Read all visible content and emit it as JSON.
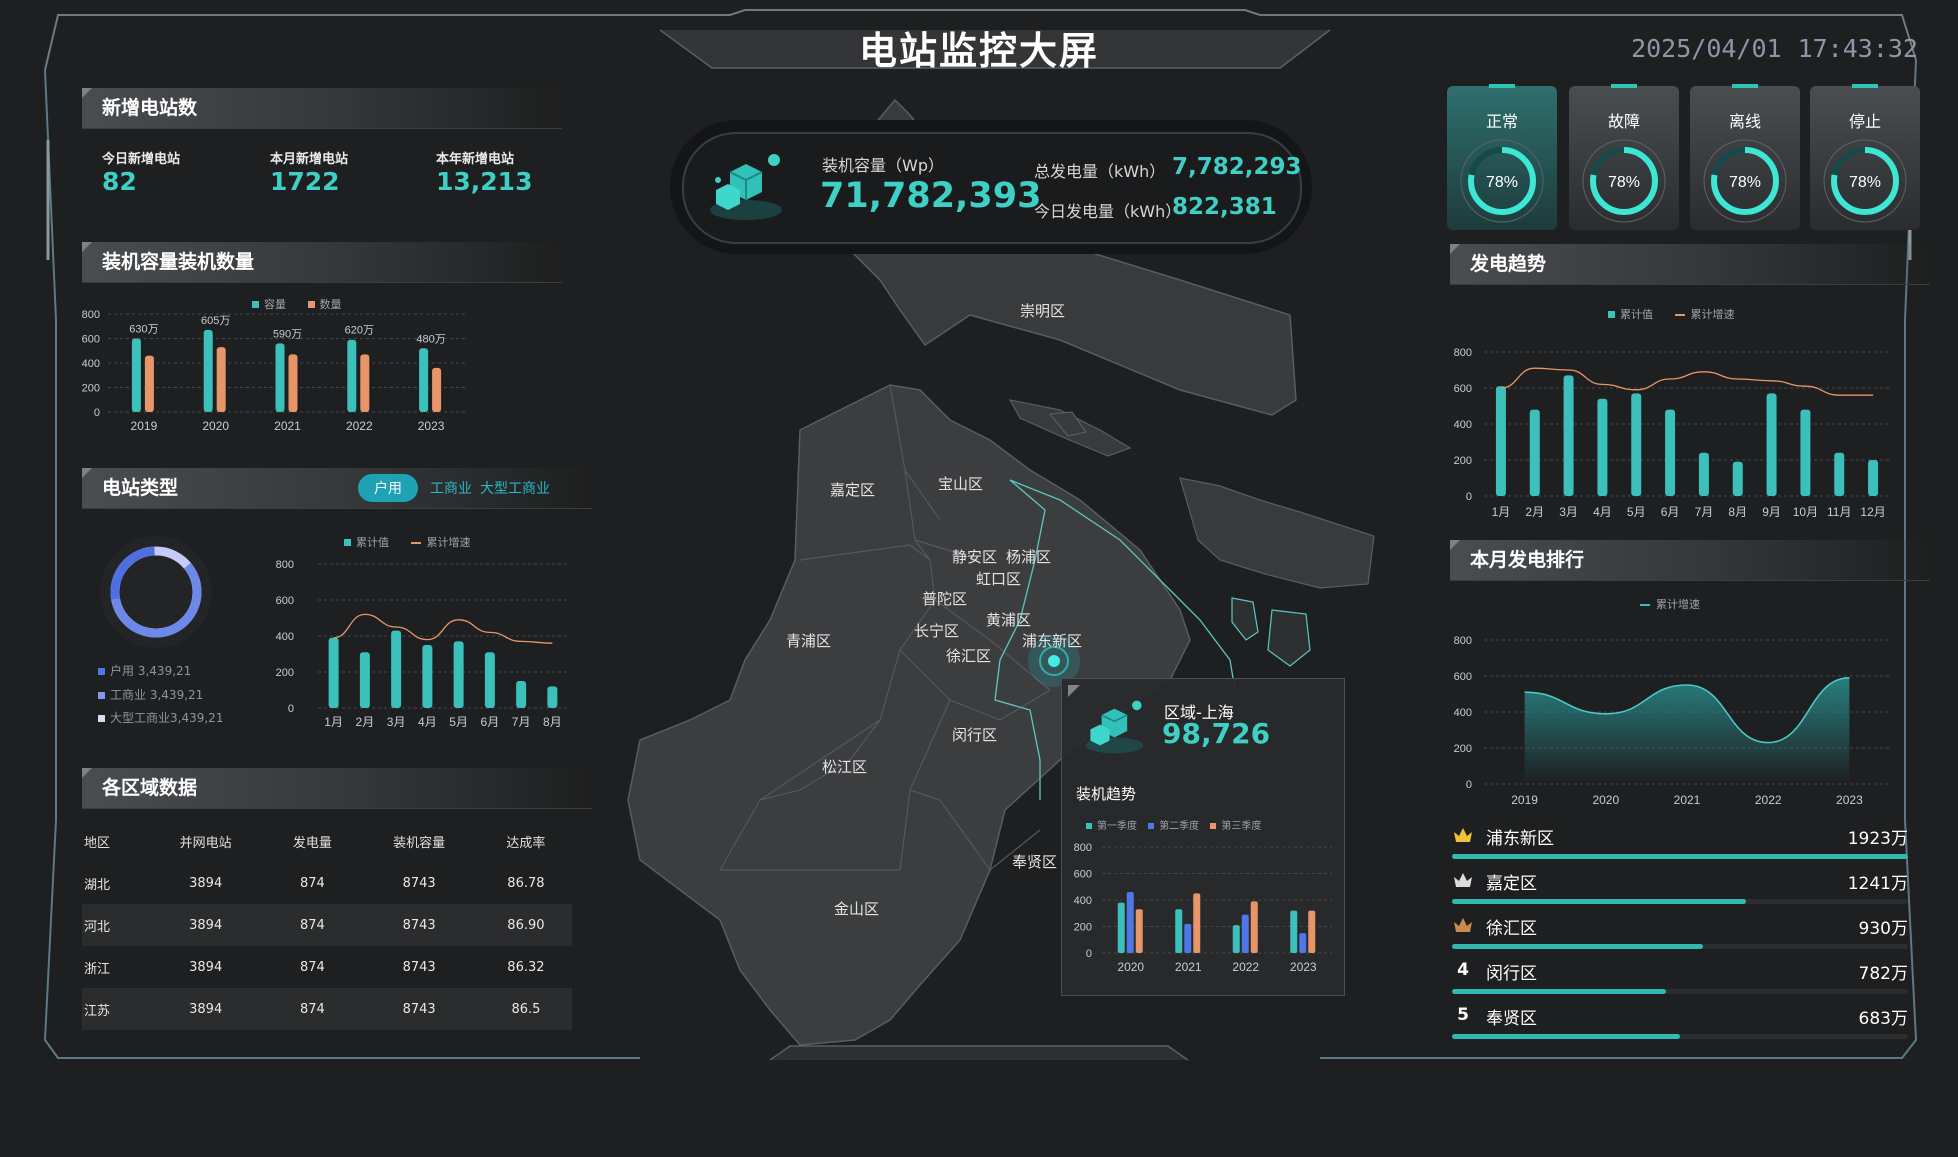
{
  "header": {
    "title": "电站监控大屏",
    "date": "2025/04/01",
    "time": "17:43:32"
  },
  "new_stations": {
    "title": "新增电站数",
    "items": [
      {
        "label": "今日新增电站",
        "value": "82"
      },
      {
        "label": "本月新增电站",
        "value": "1722"
      },
      {
        "label": "本年新增电站",
        "value": "13,213"
      }
    ]
  },
  "capacity_chart": {
    "title": "装机容量装机数量",
    "legend": [
      "容量",
      "数量"
    ]
  },
  "station_type": {
    "title": "电站类型",
    "tabs": [
      "户用",
      "工商业",
      "大型工商业"
    ],
    "donut_legend": [
      {
        "label": "户用",
        "value": "3,439,21"
      },
      {
        "label": "工商业",
        "value": "3,439,21"
      },
      {
        "label": "大型工商业",
        "value": "3,439,21"
      }
    ],
    "legend": [
      "累计值",
      "累计增速"
    ]
  },
  "region_data": {
    "title": "各区域数据",
    "columns": [
      "地区",
      "并网电站",
      "发电量",
      "装机容量",
      "达成率"
    ],
    "rows": [
      [
        "湖北",
        "3894",
        "874",
        "8743",
        "86.78"
      ],
      [
        "河北",
        "3894",
        "874",
        "8743",
        "86.90"
      ],
      [
        "浙江",
        "3894",
        "874",
        "8743",
        "86.32"
      ],
      [
        "江苏",
        "3894",
        "874",
        "8743",
        "86.5"
      ]
    ]
  },
  "summary": {
    "capacity_label": "装机容量（Wp）",
    "capacity_value": "71,782,393",
    "total_gen_label": "总发电量（kWh）",
    "total_gen_value": "7,782,293",
    "today_gen_label": "今日发电量（kWh）",
    "today_gen_value": "822,381"
  },
  "map": {
    "districts": [
      "崇明区",
      "嘉定区",
      "宝山区",
      "静安区",
      "杨浦区",
      "虹口区",
      "普陀区",
      "黄浦区",
      "长宁区",
      "青浦区",
      "徐汇区",
      "浦东新区",
      "闵行区",
      "松江区",
      "奉贤区",
      "金山区"
    ]
  },
  "popup": {
    "region": "区域-上海",
    "value": "98,726",
    "subtitle": "装机趋势",
    "legend": [
      "第一季度",
      "第二季度",
      "第三季度"
    ]
  },
  "status": [
    {
      "label": "正常",
      "percent": "78%",
      "fraction": 0.78
    },
    {
      "label": "故障",
      "percent": "78%",
      "fraction": 0.78
    },
    {
      "label": "离线",
      "percent": "78%",
      "fraction": 0.78
    },
    {
      "label": "停止",
      "percent": "78%",
      "fraction": 0.78
    }
  ],
  "gen_trend": {
    "title": "发电趋势",
    "legend": [
      "累计值",
      "累计增速"
    ]
  },
  "monthly_rank": {
    "title": "本月发电排行",
    "legend": [
      "累计增速"
    ],
    "items": [
      {
        "rank": "1",
        "name": "浦东新区",
        "value": "1923万",
        "fraction": 1.0
      },
      {
        "rank": "2",
        "name": "嘉定区",
        "value": "1241万",
        "fraction": 0.645
      },
      {
        "rank": "3",
        "name": "徐汇区",
        "value": "930万",
        "fraction": 0.55
      },
      {
        "rank": "4",
        "name": "闵行区",
        "value": "782万",
        "fraction": 0.47
      },
      {
        "rank": "5",
        "name": "奉贤区",
        "value": "683万",
        "fraction": 0.5
      }
    ]
  },
  "colors": {
    "teal": "#3cc0bc",
    "orange": "#e9956a",
    "blue": "#4f77e6",
    "background": "#1e1f20"
  },
  "chart_data": [
    {
      "id": "capacity",
      "type": "bar",
      "categories": [
        "2019",
        "2020",
        "2021",
        "2022",
        "2023"
      ],
      "series": [
        {
          "name": "容量",
          "values": [
            600,
            670,
            560,
            590,
            520
          ]
        },
        {
          "name": "数量",
          "values": [
            460,
            530,
            470,
            470,
            360
          ]
        }
      ],
      "bar_labels": [
        "630万",
        "605万",
        "590万",
        "620万",
        "480万"
      ],
      "yticks": [
        "0",
        "200",
        "400",
        "600",
        "800"
      ],
      "ylim": [
        0,
        800
      ]
    },
    {
      "id": "station_type",
      "type": "bar",
      "categories": [
        "1月",
        "2月",
        "3月",
        "4月",
        "5月",
        "6月",
        "7月",
        "8月"
      ],
      "series": [
        {
          "name": "累计值",
          "values": [
            390,
            310,
            430,
            350,
            370,
            310,
            150,
            120
          ]
        },
        {
          "name": "累计增速",
          "type": "line",
          "values": [
            390,
            520,
            450,
            380,
            490,
            420,
            370,
            360
          ]
        }
      ],
      "yticks": [
        "0",
        "200",
        "400",
        "600",
        "800"
      ],
      "ylim": [
        0,
        800
      ]
    },
    {
      "id": "gen_trend",
      "type": "bar",
      "categories": [
        "1月",
        "2月",
        "3月",
        "4月",
        "5月",
        "6月",
        "7月",
        "8月",
        "9月",
        "10月",
        "11月",
        "12月"
      ],
      "series": [
        {
          "name": "累计值",
          "values": [
            610,
            480,
            670,
            540,
            570,
            480,
            240,
            190,
            570,
            480,
            240,
            200
          ]
        },
        {
          "name": "累计增速",
          "type": "line",
          "values": [
            600,
            710,
            700,
            620,
            590,
            650,
            690,
            650,
            640,
            610,
            560,
            560
          ]
        }
      ],
      "yticks": [
        "0",
        "200",
        "400",
        "600",
        "800"
      ],
      "ylim": [
        0,
        800
      ]
    },
    {
      "id": "monthly_rank_area",
      "type": "area",
      "categories": [
        "2019",
        "2020",
        "2021",
        "2022",
        "2023"
      ],
      "series": [
        {
          "name": "累计增速",
          "values": [
            510,
            390,
            550,
            230,
            590
          ]
        }
      ],
      "yticks": [
        "0",
        "200",
        "400",
        "600",
        "800"
      ],
      "ylim": [
        0,
        800
      ]
    },
    {
      "id": "popup_trend",
      "type": "bar",
      "categories": [
        "2020",
        "2021",
        "2022",
        "2023"
      ],
      "series": [
        {
          "name": "第一季度",
          "values": [
            380,
            330,
            210,
            320
          ]
        },
        {
          "name": "第二季度",
          "values": [
            460,
            220,
            290,
            150
          ]
        },
        {
          "name": "第三季度",
          "values": [
            330,
            450,
            390,
            320
          ]
        }
      ],
      "yticks": [
        "0",
        "200",
        "400",
        "600",
        "800"
      ],
      "ylim": [
        0,
        800
      ]
    }
  ]
}
